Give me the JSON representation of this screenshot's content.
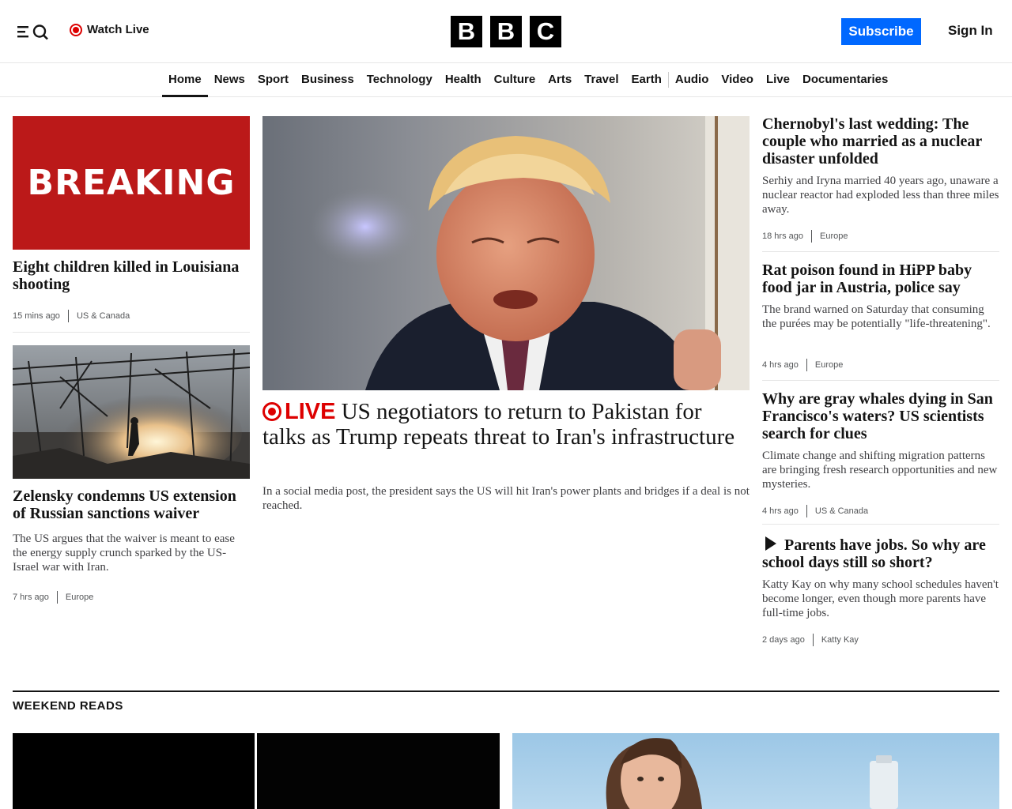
{
  "header": {
    "watch_live": "Watch Live",
    "logo": [
      "B",
      "B",
      "C"
    ],
    "subscribe": "Subscribe",
    "sign_in": "Sign In"
  },
  "nav": {
    "items": [
      "Home",
      "News",
      "Sport",
      "Business",
      "Technology",
      "Health",
      "Culture",
      "Arts",
      "Travel",
      "Earth",
      "Audio",
      "Video",
      "Live",
      "Documentaries"
    ],
    "active": "Home"
  },
  "left": {
    "story1": {
      "image_text": "BREAKING",
      "headline": "Eight children killed in Louisiana shooting",
      "time": "15 mins ago",
      "tag": "US & Canada"
    },
    "story2": {
      "headline": "Zelensky condemns US extension of Russian sanctions waiver",
      "summary": "The US argues that the waiver is meant to ease the energy supply crunch sparked by the US-Israel war with Iran.",
      "time": "7 hrs ago",
      "tag": "Europe"
    }
  },
  "center": {
    "live_label": "LIVE",
    "headline": "US negotiators to return to Pakistan for talks as Trump repeats threat to Iran's infrastructure",
    "summary": "In a social media post, the president says the US will hit Iran's power plants and bridges if a deal is not reached."
  },
  "right": {
    "stories": [
      {
        "headline": "Chernobyl's last wedding: The couple who married as a nuclear disaster unfolded",
        "summary": "Serhiy and Iryna married 40 years ago, unaware a nuclear reactor had exploded less than three miles away.",
        "time": "18 hrs ago",
        "tag": "Europe"
      },
      {
        "headline": "Rat poison found in HiPP baby food jar in Austria, police say",
        "summary": "The brand warned on Saturday that consuming the purées may be potentially \"life-threatening\".",
        "time": "4 hrs ago",
        "tag": "Europe"
      },
      {
        "headline": "Why are gray whales dying in San Francisco's waters? US scientists search for clues",
        "summary": "Climate change and shifting migration patterns are bringing fresh research opportunities and new mysteries.",
        "time": "4 hrs ago",
        "tag": "US & Canada"
      },
      {
        "headline": "Parents have jobs. So why are school days still so short?",
        "summary": "Katty Kay on why many school schedules haven't become longer, even though more parents have full-time jobs.",
        "time": "2 days ago",
        "tag": "Katty Kay"
      }
    ]
  },
  "weekend": {
    "title": "WEEKEND READS"
  },
  "colors": {
    "accent_blue": "#0068ff",
    "live_red": "#dd0000",
    "breaking_red": "#bb1919"
  }
}
